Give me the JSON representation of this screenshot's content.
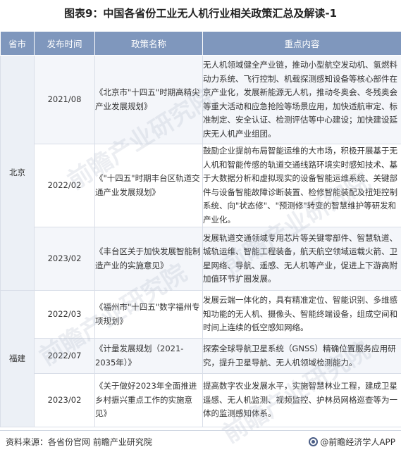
{
  "title": "图表9：中国各省份工业无人机行业相关政策汇总及解读-1",
  "headers": {
    "province": "省市",
    "date": "发布时间",
    "name": "政策名称",
    "content": "重点内容"
  },
  "rows": [
    {
      "province": "北京",
      "date": "2021/08",
      "name": "《北京市\"十四五\"时期高精尖产业发展规划》",
      "content": "无人机领域健全产业链，推动小型航空发动机、氢燃料动力系统、飞行控制、机载探测感知设备等核心部件在京产业化，发展新能源无人机，推动冬奥会、冬残奥会等重大活动和应急抢险等场景应用，加快适航审定、标准制定、安全认证、检测评估等中心建设；加快建设延庆无人机产业组团。"
    },
    {
      "province": "",
      "date": "2022/02",
      "name": "《\"十四五\"时期丰台区轨道交通产业发展规划》",
      "content": "鼓励企业提前布局智能运维的大市场，积极开展基于无人机和智能传感的轨道交通线路环境实时感知技术、基于大数据分析和虚拟现实的设备智能运维系统、关键部件与设备智能故障诊断装置、检修智能装配及扭矩控制系统、向\"状态修\"、\"预测修\"转变的智慧维护等研发和产业化。"
    },
    {
      "province": "",
      "date": "2023/02",
      "name": "《丰台区关于加快发展智能制造产业的实施意见》",
      "content": "发展轨道交通领域专用芯片等关键零部件、智慧轨道、城轨运维、智能工程装备，航天航空领域运载火箭、卫星网络、导航、遥感、无人机等产业，促进上下游高附加值环节扩圈发展。"
    },
    {
      "province": "福建",
      "date": "2022/03",
      "name": "《福州市\"十四五\"数字福州专项规划》",
      "content": "发展云端一体化的，具有精准定位、智能识别、多维感知功能的无人机、摄像头、智能终端设备，组成空间和时间上连续的低空感知网络。"
    },
    {
      "province": "",
      "date": "2022/07",
      "name": "《计量发展规划（2021-2035年）》",
      "content": "探索全球导航卫星系统（GNSS）精确位置服务应用研究，提升卫星导航、无人机领域检测能力。"
    },
    {
      "province": "",
      "date": "2023/02",
      "name": "《关于做好2023年全面推进乡村振兴重点工作的实施意见》",
      "content": "提高数字农业发展水平，实施智慧林业工程，建成卫星遥感、无人机监测、视频监控、护林员网格巡查等为一体的监测感知体系。"
    }
  ],
  "watermark": "前瞻产业研究院",
  "footer": {
    "source": "资料来源：各省份官网 前瞻产业研究院",
    "brand": "@前瞻经济学人APP"
  },
  "colors": {
    "header_bg": "#7f97bd",
    "province_bg": "#ecf0f6",
    "row_shade": "#f4f6fa"
  }
}
